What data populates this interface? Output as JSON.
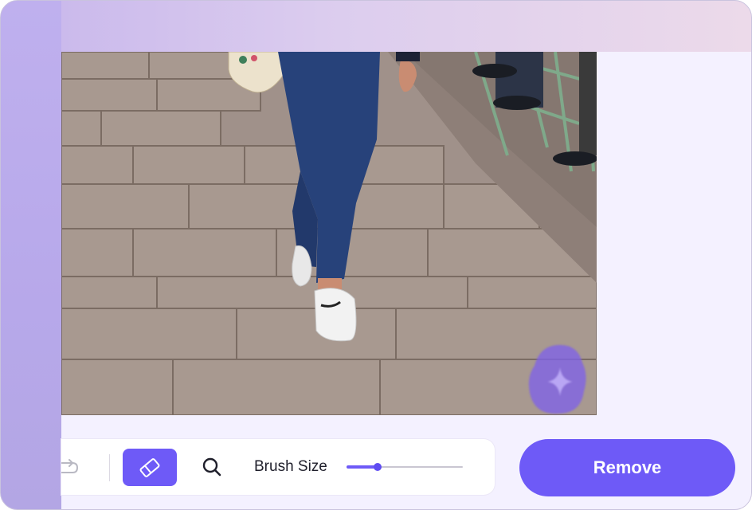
{
  "toolbar": {
    "brush_label": "Brush Size",
    "brush_size_fraction": 0.27,
    "active_tool": "eraser",
    "icons": {
      "redo": "redo-icon",
      "eraser": "eraser-icon",
      "zoom": "search-icon"
    }
  },
  "actions": {
    "remove_label": "Remove"
  },
  "colors": {
    "accent": "#6e5af7",
    "panel": "#f4f1ff"
  }
}
